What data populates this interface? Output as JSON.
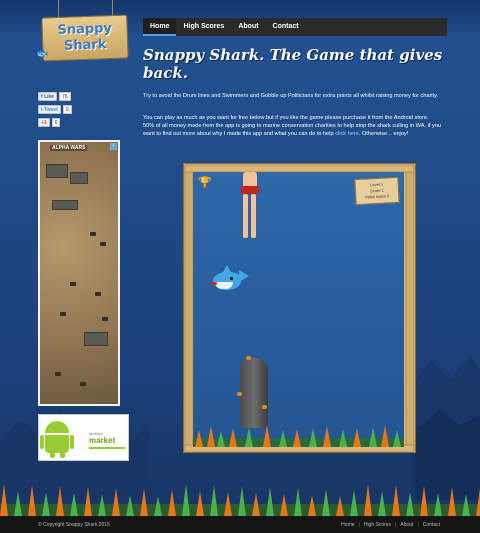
{
  "logo": {
    "line1": "Snappy",
    "line2": "Shark"
  },
  "nav": [
    {
      "label": "Home",
      "active": true
    },
    {
      "label": "High Scores",
      "active": false
    },
    {
      "label": "About",
      "active": false
    },
    {
      "label": "Contact",
      "active": false
    }
  ],
  "page": {
    "title": "Snappy Shark. The Game that gives back.",
    "para1": "Try to avoid the Drum lines and Swimmers and Gobble up Politicians for extra points all whilst raising money for charity.",
    "para2_before_link": "You can play as much as you want for free below but if you like the game please purchase it from the Android store. 50% of all money made from the app is going to marine conservation charities to help stop the shark culling in WA. if you want to find out more about why I made this app and what you can do to help",
    "para2_link": "click here",
    "para2_after_link": ". Otherwise... enjoy!"
  },
  "social": {
    "facebook": {
      "label": "Like",
      "count": "76"
    },
    "twitter": {
      "label": "Tweet",
      "count": "0"
    },
    "gplus": {
      "label": "+1",
      "count": "0"
    }
  },
  "ad": {
    "title": "ALPHA WARS"
  },
  "market": {
    "small": "android",
    "big": "market"
  },
  "game": {
    "scoreboard": {
      "level": "Level 1",
      "score": "Score 1",
      "pollies": "Pollis eaten 0"
    }
  },
  "footer": {
    "copyright": "© Copyright Snappy Shark 2015",
    "links": [
      "Home",
      "High Scores",
      "About",
      "Contact"
    ]
  },
  "colors": {
    "accent": "#4ea0e0",
    "background": "#1d3e78",
    "shark": "#45a6e5"
  }
}
